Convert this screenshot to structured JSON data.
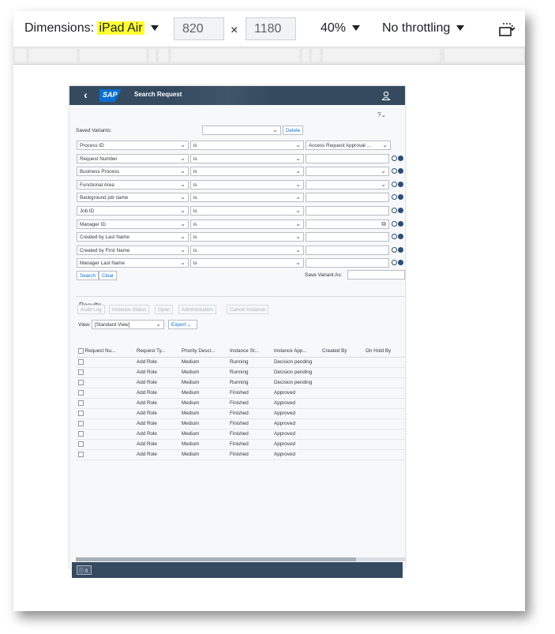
{
  "toolbar": {
    "dimensions_label": "Dimensions:",
    "device": "iPad Air",
    "width": "820",
    "separator": "×",
    "height": "1180",
    "zoom": "40%",
    "throttling": "No throttling",
    "highlight_color": "#ffff33"
  },
  "shell": {
    "logo": "SAP",
    "title": "Search Request",
    "bar_color": "#354a5f"
  },
  "filter": {
    "saved_variants_label": "Saved Variants:",
    "saved_variants_value": "",
    "delete_label": "Delete",
    "rows": [
      {
        "field": "Process ID",
        "op": "is",
        "value": "Access Request Approval ...",
        "value_type": "dropdown",
        "icons": ""
      },
      {
        "field": "Request Number",
        "op": "is",
        "value": "",
        "value_type": "text",
        "icons": "minus-plus"
      },
      {
        "field": "Business Process",
        "op": "is",
        "value": "",
        "value_type": "dropdown",
        "icons": "minus-plus"
      },
      {
        "field": "Functional Area",
        "op": "is",
        "value": "",
        "value_type": "dropdown",
        "icons": "minus-plus"
      },
      {
        "field": "Background job name",
        "op": "is",
        "value": "",
        "value_type": "text",
        "icons": "minus-plus"
      },
      {
        "field": "Job ID",
        "op": "is",
        "value": "",
        "value_type": "text",
        "icons": "minus-gear"
      },
      {
        "field": "Manager ID",
        "op": "is",
        "value": "",
        "value_type": "lookup",
        "icons": "minus-plus"
      },
      {
        "field": "Created by Last Name",
        "op": "is",
        "value": "",
        "value_type": "text",
        "icons": "minus-plus"
      },
      {
        "field": "Created by  First Name",
        "op": "is",
        "value": "",
        "value_type": "text",
        "icons": "minus-plus"
      },
      {
        "field": "Manager Last Name",
        "op": "is",
        "value": "",
        "value_type": "text",
        "icons": "minus-plus"
      }
    ],
    "search_label": "Search",
    "clear_label": "Clear",
    "save_variant_label": "Save Variant As:",
    "save_variant_value": ""
  },
  "results": {
    "title": "Results",
    "actions": [
      "Audit Log",
      "Instance Status",
      "Open",
      "Administration",
      "Cancel Instance"
    ],
    "view_label": "View:",
    "view_value": "[Standard View]",
    "export_label": "Export",
    "columns": [
      "Request Nu...",
      "Request Ty...",
      "Priority Descr...",
      "Instance St...",
      "Instance App...",
      "Created By",
      "On Hold By"
    ],
    "rows": [
      [
        "",
        "Add Role",
        "Medium",
        "Running",
        "Decision pending",
        "",
        ""
      ],
      [
        "",
        "Add Role",
        "Medium",
        "Running",
        "Decision pending",
        "",
        ""
      ],
      [
        "",
        "Add Role",
        "Medium",
        "Running",
        "Decision pending",
        "",
        ""
      ],
      [
        "",
        "Add Role",
        "Medium",
        "Finished",
        "Approved",
        "",
        ""
      ],
      [
        "",
        "Add Role",
        "Medium",
        "Finished",
        "Approved",
        "",
        ""
      ],
      [
        "",
        "Add Role",
        "Medium",
        "Finished",
        "Approved",
        "",
        ""
      ],
      [
        "",
        "Add Role",
        "Medium",
        "Finished",
        "Approved",
        "",
        ""
      ],
      [
        "",
        "Add Role",
        "Medium",
        "Finished",
        "Approved",
        "",
        ""
      ],
      [
        "",
        "Add Role",
        "Medium",
        "Finished",
        "Approved",
        "",
        ""
      ],
      [
        "",
        "Add Role",
        "Medium",
        "Finished",
        "Approved",
        "",
        ""
      ]
    ]
  },
  "footer": {
    "message_count": "0"
  }
}
